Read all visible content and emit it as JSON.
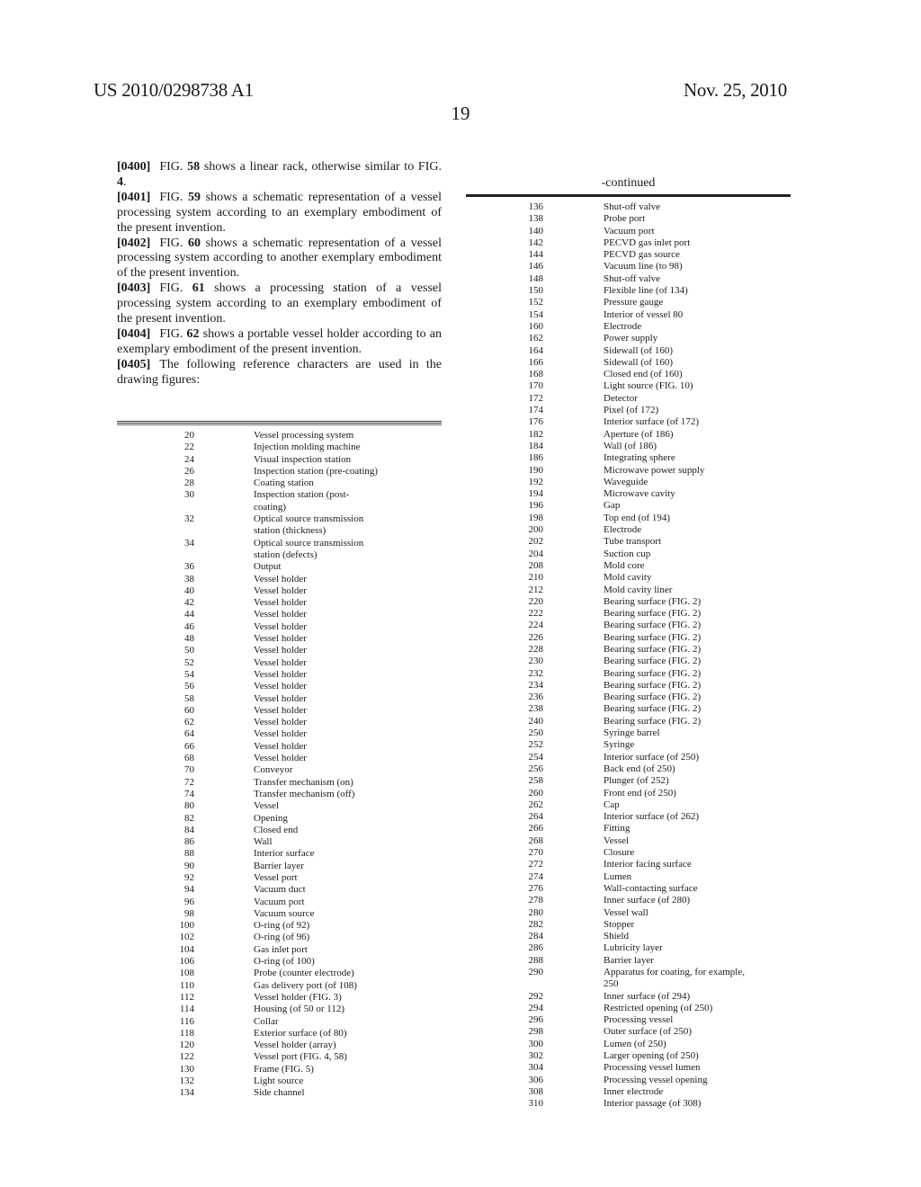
{
  "header": {
    "patent_number": "US 2010/0298738 A1",
    "date": "Nov. 25, 2010",
    "page_number": "19"
  },
  "paragraphs": [
    {
      "num": "[0400]",
      "prefix": "FIG. ",
      "fig": "58",
      "text": " shows a linear rack, otherwise similar to FIG. ",
      "fig2": "4",
      "suffix": "."
    },
    {
      "num": "[0401]",
      "prefix": "FIG. ",
      "fig": "59",
      "text": " shows a schematic representation of a vessel processing system according to an exemplary embodiment of the present invention.",
      "fig2": "",
      "suffix": ""
    },
    {
      "num": "[0402]",
      "prefix": "FIG. ",
      "fig": "60",
      "text": " shows a schematic representation of a vessel processing system according to another exemplary embodiment of the present invention.",
      "fig2": "",
      "suffix": ""
    },
    {
      "num": "[0403]",
      "prefix": "FIG. ",
      "fig": "61",
      "text": " shows a processing station of a vessel processing system according to an exemplary embodiment of the present invention.",
      "fig2": "",
      "suffix": ""
    },
    {
      "num": "[0404]",
      "prefix": "FIG. ",
      "fig": "62",
      "text": " shows a portable vessel holder according to an exemplary embodiment of the present invention.",
      "fig2": "",
      "suffix": ""
    },
    {
      "num": "[0405]",
      "prefix": "",
      "fig": "",
      "text": "The following reference characters are used in the drawing figures:",
      "fig2": "",
      "suffix": ""
    }
  ],
  "table_left": [
    {
      "ref": "20",
      "desc": "Vessel processing system"
    },
    {
      "ref": "22",
      "desc": "Injection molding machine"
    },
    {
      "ref": "24",
      "desc": "Visual inspection station"
    },
    {
      "ref": "26",
      "desc": "Inspection station (pre-coating)"
    },
    {
      "ref": "28",
      "desc": "Coating station"
    },
    {
      "ref": "30",
      "desc": "Inspection station (post-coating)"
    },
    {
      "ref": "32",
      "desc": "Optical source transmission station (thickness)"
    },
    {
      "ref": "34",
      "desc": "Optical source transmission station (defects)"
    },
    {
      "ref": "36",
      "desc": "Output"
    },
    {
      "ref": "38",
      "desc": "Vessel holder"
    },
    {
      "ref": "40",
      "desc": "Vessel holder"
    },
    {
      "ref": "42",
      "desc": "Vessel holder"
    },
    {
      "ref": "44",
      "desc": "Vessel holder"
    },
    {
      "ref": "46",
      "desc": "Vessel holder"
    },
    {
      "ref": "48",
      "desc": "Vessel holder"
    },
    {
      "ref": "50",
      "desc": "Vessel holder"
    },
    {
      "ref": "52",
      "desc": "Vessel holder"
    },
    {
      "ref": "54",
      "desc": "Vessel holder"
    },
    {
      "ref": "56",
      "desc": "Vessel holder"
    },
    {
      "ref": "58",
      "desc": "Vessel holder"
    },
    {
      "ref": "60",
      "desc": "Vessel holder"
    },
    {
      "ref": "62",
      "desc": "Vessel holder"
    },
    {
      "ref": "64",
      "desc": "Vessel holder"
    },
    {
      "ref": "66",
      "desc": "Vessel holder"
    },
    {
      "ref": "68",
      "desc": "Vessel holder"
    },
    {
      "ref": "70",
      "desc": "Conveyor"
    },
    {
      "ref": "72",
      "desc": "Transfer mechanism (on)"
    },
    {
      "ref": "74",
      "desc": "Transfer mechanism (off)"
    },
    {
      "ref": "80",
      "desc": "Vessel"
    },
    {
      "ref": "82",
      "desc": "Opening"
    },
    {
      "ref": "84",
      "desc": "Closed end"
    },
    {
      "ref": "86",
      "desc": "Wall"
    },
    {
      "ref": "88",
      "desc": "Interior surface"
    },
    {
      "ref": "90",
      "desc": "Barrier layer"
    },
    {
      "ref": "92",
      "desc": "Vessel port"
    },
    {
      "ref": "94",
      "desc": "Vacuum duct"
    },
    {
      "ref": "96",
      "desc": "Vacuum port"
    },
    {
      "ref": "98",
      "desc": "Vacuum source"
    },
    {
      "ref": "100",
      "desc": "O-ring (of 92)"
    },
    {
      "ref": "102",
      "desc": "O-ring (of 96)"
    },
    {
      "ref": "104",
      "desc": "Gas inlet port"
    },
    {
      "ref": "106",
      "desc": "O-ring (of 100)"
    },
    {
      "ref": "108",
      "desc": "Probe (counter electrode)"
    },
    {
      "ref": "110",
      "desc": "Gas delivery port (of 108)"
    },
    {
      "ref": "112",
      "desc": "Vessel holder (FIG. 3)"
    },
    {
      "ref": "114",
      "desc": "Housing (of 50 or 112)"
    },
    {
      "ref": "116",
      "desc": "Collar"
    },
    {
      "ref": "118",
      "desc": "Exterior surface (of 80)"
    },
    {
      "ref": "120",
      "desc": "Vessel holder (array)"
    },
    {
      "ref": "122",
      "desc": "Vessel port (FIG. 4, 58)"
    },
    {
      "ref": "130",
      "desc": "Frame (FIG. 5)"
    },
    {
      "ref": "132",
      "desc": "Light source"
    },
    {
      "ref": "134",
      "desc": "Side channel"
    }
  ],
  "table_right_title": "-continued",
  "table_right": [
    {
      "ref": "136",
      "desc": "Shut-off valve"
    },
    {
      "ref": "138",
      "desc": "Probe port"
    },
    {
      "ref": "140",
      "desc": "Vacuum port"
    },
    {
      "ref": "142",
      "desc": "PECVD gas inlet port"
    },
    {
      "ref": "144",
      "desc": "PECVD gas source"
    },
    {
      "ref": "146",
      "desc": "Vacuum line (to 98)"
    },
    {
      "ref": "148",
      "desc": "Shut-off valve"
    },
    {
      "ref": "150",
      "desc": "Flexible line (of 134)"
    },
    {
      "ref": "152",
      "desc": "Pressure gauge"
    },
    {
      "ref": "154",
      "desc": "Interior of vessel 80"
    },
    {
      "ref": "160",
      "desc": "Electrode"
    },
    {
      "ref": "162",
      "desc": "Power supply"
    },
    {
      "ref": "164",
      "desc": "Sidewall (of 160)"
    },
    {
      "ref": "166",
      "desc": "Sidewall (of 160)"
    },
    {
      "ref": "168",
      "desc": "Closed end (of 160)"
    },
    {
      "ref": "170",
      "desc": "Light source (FIG. 10)"
    },
    {
      "ref": "172",
      "desc": "Detector"
    },
    {
      "ref": "174",
      "desc": "Pixel (of 172)"
    },
    {
      "ref": "176",
      "desc": "Interior surface (of 172)"
    },
    {
      "ref": "182",
      "desc": "Aperture (of 186)"
    },
    {
      "ref": "184",
      "desc": "Wall (of 186)"
    },
    {
      "ref": "186",
      "desc": "Integrating sphere"
    },
    {
      "ref": "190",
      "desc": "Microwave power supply"
    },
    {
      "ref": "192",
      "desc": "Waveguide"
    },
    {
      "ref": "194",
      "desc": "Microwave cavity"
    },
    {
      "ref": "196",
      "desc": "Gap"
    },
    {
      "ref": "198",
      "desc": "Top end (of 194)"
    },
    {
      "ref": "200",
      "desc": "Electrode"
    },
    {
      "ref": "202",
      "desc": "Tube transport"
    },
    {
      "ref": "204",
      "desc": "Suction cup"
    },
    {
      "ref": "208",
      "desc": "Mold core"
    },
    {
      "ref": "210",
      "desc": "Mold cavity"
    },
    {
      "ref": "212",
      "desc": "Mold cavity liner"
    },
    {
      "ref": "220",
      "desc": "Bearing surface (FIG. 2)"
    },
    {
      "ref": "222",
      "desc": "Bearing surface (FIG. 2)"
    },
    {
      "ref": "224",
      "desc": "Bearing surface (FIG. 2)"
    },
    {
      "ref": "226",
      "desc": "Bearing surface (FIG. 2)"
    },
    {
      "ref": "228",
      "desc": "Bearing surface (FIG. 2)"
    },
    {
      "ref": "230",
      "desc": "Bearing surface (FIG. 2)"
    },
    {
      "ref": "232",
      "desc": "Bearing surface (FIG. 2)"
    },
    {
      "ref": "234",
      "desc": "Bearing surface (FIG. 2)"
    },
    {
      "ref": "236",
      "desc": "Bearing surface (FIG. 2)"
    },
    {
      "ref": "238",
      "desc": "Bearing surface (FIG. 2)"
    },
    {
      "ref": "240",
      "desc": "Bearing surface (FIG. 2)"
    },
    {
      "ref": "250",
      "desc": "Syringe barrel"
    },
    {
      "ref": "252",
      "desc": "Syringe"
    },
    {
      "ref": "254",
      "desc": "Interior surface (of 250)"
    },
    {
      "ref": "256",
      "desc": "Back end (of 250)"
    },
    {
      "ref": "258",
      "desc": "Plunger (of 252)"
    },
    {
      "ref": "260",
      "desc": "Front end (of 250)"
    },
    {
      "ref": "262",
      "desc": "Cap"
    },
    {
      "ref": "264",
      "desc": "Interior surface (of 262)"
    },
    {
      "ref": "266",
      "desc": "Fitting"
    },
    {
      "ref": "268",
      "desc": "Vessel"
    },
    {
      "ref": "270",
      "desc": "Closure"
    },
    {
      "ref": "272",
      "desc": "Interior facing surface"
    },
    {
      "ref": "274",
      "desc": "Lumen"
    },
    {
      "ref": "276",
      "desc": "Wall-contacting surface"
    },
    {
      "ref": "278",
      "desc": "Inner surface (of 280)"
    },
    {
      "ref": "280",
      "desc": "Vessel wall"
    },
    {
      "ref": "282",
      "desc": "Stopper"
    },
    {
      "ref": "284",
      "desc": "Shield"
    },
    {
      "ref": "286",
      "desc": "Lubricity layer"
    },
    {
      "ref": "288",
      "desc": "Barrier layer"
    },
    {
      "ref": "290",
      "desc": "Apparatus for coating, for example, 250"
    },
    {
      "ref": "292",
      "desc": "Inner surface (of 294)"
    },
    {
      "ref": "294",
      "desc": "Restricted opening (of 250)"
    },
    {
      "ref": "296",
      "desc": "Processing vessel"
    },
    {
      "ref": "298",
      "desc": "Outer surface (of 250)"
    },
    {
      "ref": "300",
      "desc": "Lumen (of 250)"
    },
    {
      "ref": "302",
      "desc": "Larger opening (of 250)"
    },
    {
      "ref": "304",
      "desc": "Processing vessel lumen"
    },
    {
      "ref": "306",
      "desc": "Processing vessel opening"
    },
    {
      "ref": "308",
      "desc": "Inner electrode"
    },
    {
      "ref": "310",
      "desc": "Interior passage (of 308)"
    }
  ]
}
